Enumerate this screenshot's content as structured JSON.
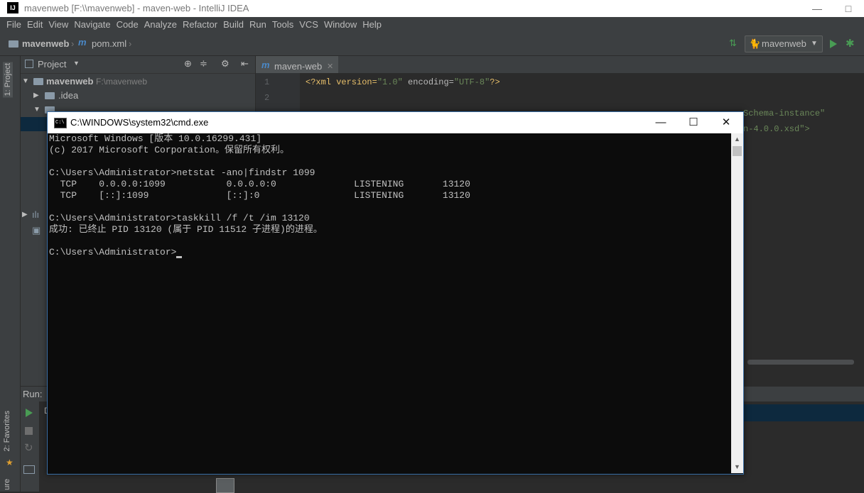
{
  "ide": {
    "window_title": "mavenweb [F:\\\\mavenweb] - maven-web - IntelliJ IDEA",
    "logo_text": "IJ",
    "menu": [
      "File",
      "Edit",
      "View",
      "Navigate",
      "Code",
      "Analyze",
      "Refactor",
      "Build",
      "Run",
      "Tools",
      "VCS",
      "Window",
      "Help"
    ],
    "breadcrumb": {
      "project": "mavenweb",
      "file": "pom.xml"
    },
    "run_config": "mavenweb",
    "left_tabs": {
      "project": "1: Project",
      "favorites": "2: Favorites",
      "structure": "ure"
    }
  },
  "project_panel": {
    "header": "Project",
    "root_name": "mavenweb",
    "root_path": "F:\\mavenweb",
    "idea_folder": ".idea"
  },
  "editor": {
    "tab": "maven-web",
    "line_numbers": [
      "1",
      "2"
    ],
    "code": {
      "p1": "<?xml version=",
      "v1": "\"1.0\"",
      "p2": " encoding=",
      "v2": "\"UTF-8\"",
      "p3": "?>"
    },
    "visible_frag_1": "Schema-instance\"",
    "visible_frag_2": "n-4.0.0.xsd\">"
  },
  "run_panel": {
    "label": "Run:",
    "tab_fragment": "D"
  },
  "cmd": {
    "title": "C:\\WINDOWS\\system32\\cmd.exe",
    "lines": [
      "Microsoft Windows [版本 10.0.16299.431]",
      "(c) 2017 Microsoft Corporation。保留所有权利。",
      "",
      "C:\\Users\\Administrator>netstat -ano|findstr 1099",
      "  TCP    0.0.0.0:1099           0.0.0.0:0              LISTENING       13120",
      "  TCP    [::]:1099              [::]:0                 LISTENING       13120",
      "",
      "C:\\Users\\Administrator>taskkill /f /t /im 13120",
      "成功: 已终止 PID 13120 (属于 PID 11512 子进程)的进程。",
      "",
      "C:\\Users\\Administrator>"
    ],
    "colors": {
      "background": "#0c0c0c",
      "text": "#c0c0c0"
    }
  }
}
